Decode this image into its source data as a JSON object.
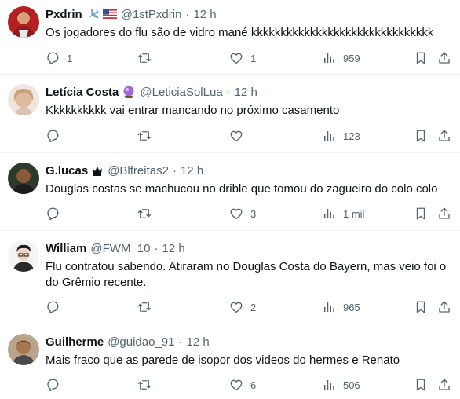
{
  "tweets": [
    {
      "name": "Pxdrin",
      "badges": [
        "airplane-emoji",
        "us-flag-emoji"
      ],
      "handle": "@1stPxdrin",
      "dot": "·",
      "time": "12 h",
      "text": "Os jogadores do flu são de vidro mané kkkkkkkkkkkkkkkkkkkkkkkkkkkkkkk",
      "replies": "1",
      "retweets": "",
      "likes": "1",
      "views": "959",
      "avatar_color": "#8a1c1c"
    },
    {
      "name": "Letícia Costa",
      "badges": [
        "crystal-ball-emoji"
      ],
      "handle": "@LeticiaSolLua",
      "dot": "·",
      "time": "12 h",
      "text": "Kkkkkkkkkk vai entrar mancando no próximo casamento",
      "replies": "",
      "retweets": "",
      "likes": "",
      "views": "123",
      "avatar_color": "#e6c6b4"
    },
    {
      "name": "G.lucas",
      "badges": [
        "crown-symbol"
      ],
      "handle": "@Blfreitas2",
      "dot": "·",
      "time": "12 h",
      "text": "Douglas costas se machucou no drible que tomou do zagueiro do colo colo",
      "replies": "",
      "retweets": "",
      "likes": "3",
      "views": "1 mil",
      "avatar_color": "#4a3a2c"
    },
    {
      "name": "William",
      "badges": [],
      "handle": "@FWM_10",
      "dot": "·",
      "time": "12 h",
      "text": "Flu contratou sabendo. Atiraram no Douglas Costa do Bayern, mas veio foi o do Grêmio recente.",
      "replies": "",
      "retweets": "",
      "likes": "2",
      "views": "965",
      "avatar_color": "#f2f2f2"
    },
    {
      "name": "Guilherme",
      "badges": [],
      "handle": "@guidao_91",
      "dot": "·",
      "time": "12 h",
      "text": "Mais fraco que as parede de isopor dos videos do hermes e Renato",
      "replies": "",
      "retweets": "",
      "likes": "6",
      "views": "506",
      "avatar_color": "#6b5a4a"
    }
  ],
  "colors": {
    "text": "#0f1419",
    "muted": "#536471",
    "divider": "#eff3f4"
  }
}
